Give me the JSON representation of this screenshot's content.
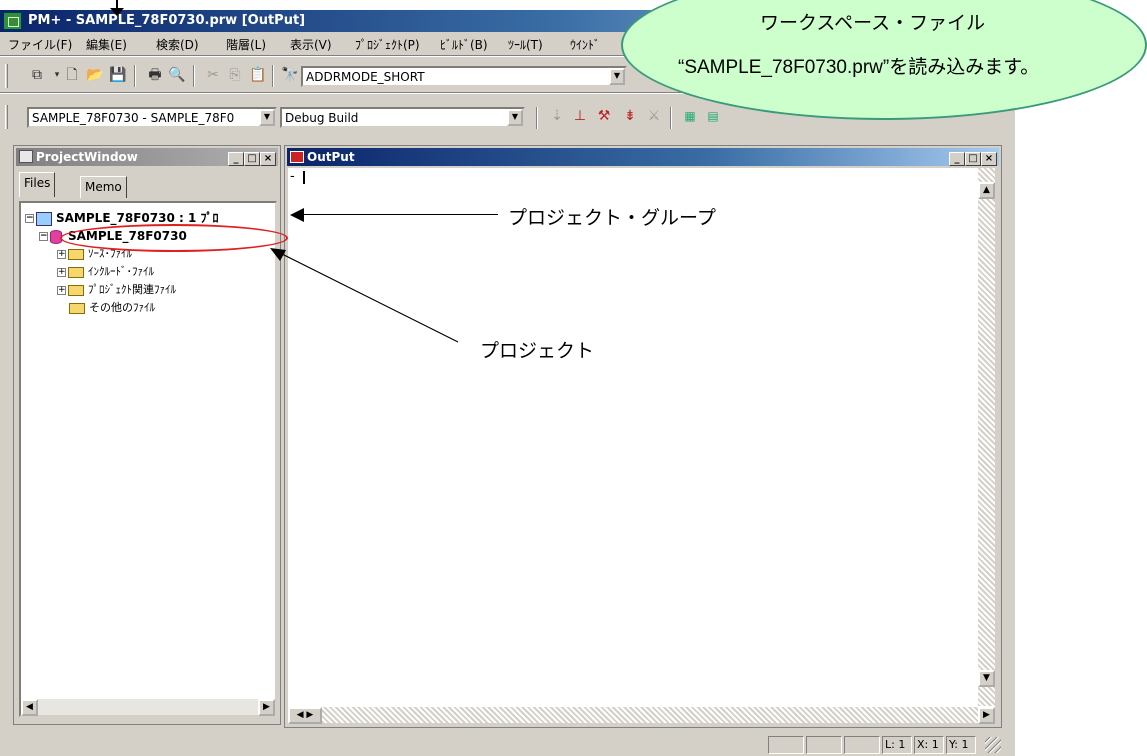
{
  "window": {
    "title": "PM+ - SAMPLE_78F0730.prw [OutPut]"
  },
  "menu": [
    "ファイル(F)",
    "編集(E)",
    "検索(D)",
    "階層(L)",
    "表示(V)",
    "ﾌﾟﾛｼﾞｪｸﾄ(P)",
    "ﾋﾞﾙﾄﾞ(B)",
    "ﾂｰﾙ(T)",
    "ｳｲﾝﾄﾞ"
  ],
  "toolbar1": {
    "combo_value": "ADDRMODE_SHORT"
  },
  "toolbar2": {
    "project_combo": "SAMPLE_78F0730 - SAMPLE_78F0",
    "build_combo": "Debug Build"
  },
  "project_window": {
    "title": "ProjectWindow",
    "tabs": [
      "Files",
      "Memo"
    ],
    "tree": {
      "group": "SAMPLE_78F0730 : 1 ﾌﾟﾛ",
      "project": "SAMPLE_78F0730",
      "folders": [
        "ｿｰｽ･ﾌｧｲﾙ",
        "ｲﾝｸﾙｰﾄﾞ･ﾌｧｲﾙ",
        "ﾌﾟﾛｼﾞｪｸﾄ関連ﾌｧｲﾙ",
        "その他のﾌｧｲﾙ"
      ]
    }
  },
  "output_window": {
    "title": "OutPut",
    "content": "-"
  },
  "status": {
    "line": "L: 1",
    "x": "X: 1",
    "y": "Y: 1"
  },
  "annotations": {
    "callout_line1": "ワークスペース・ファイル",
    "callout_line2": "“SAMPLE_78F0730.prw”を読み込みます。",
    "group_label": "プロジェクト・グループ",
    "project_label": "プロジェクト",
    "callout_fill": "#ccffcc",
    "highlight_color": "#e02020"
  }
}
